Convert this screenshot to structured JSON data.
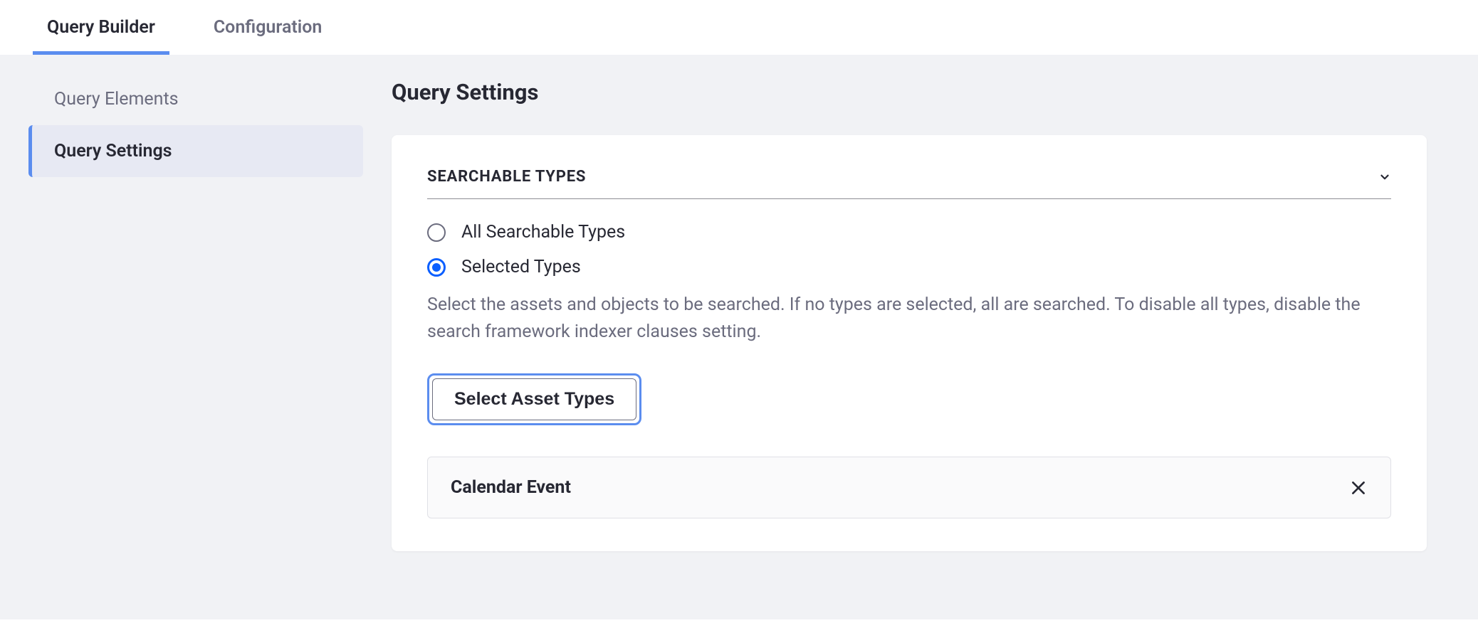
{
  "topTabs": {
    "queryBuilder": "Query Builder",
    "configuration": "Configuration"
  },
  "sidebar": {
    "queryElements": "Query Elements",
    "querySettings": "Query Settings"
  },
  "main": {
    "title": "Query Settings",
    "section": {
      "header": "SEARCHABLE TYPES",
      "radioAll": "All Searchable Types",
      "radioSelected": "Selected Types",
      "helper": "Select the assets and objects to be searched. If no types are selected, all are searched. To disable all types, disable the search framework indexer clauses setting.",
      "selectButton": "Select Asset Types",
      "selectedTypes": [
        {
          "label": "Calendar Event"
        }
      ]
    }
  }
}
